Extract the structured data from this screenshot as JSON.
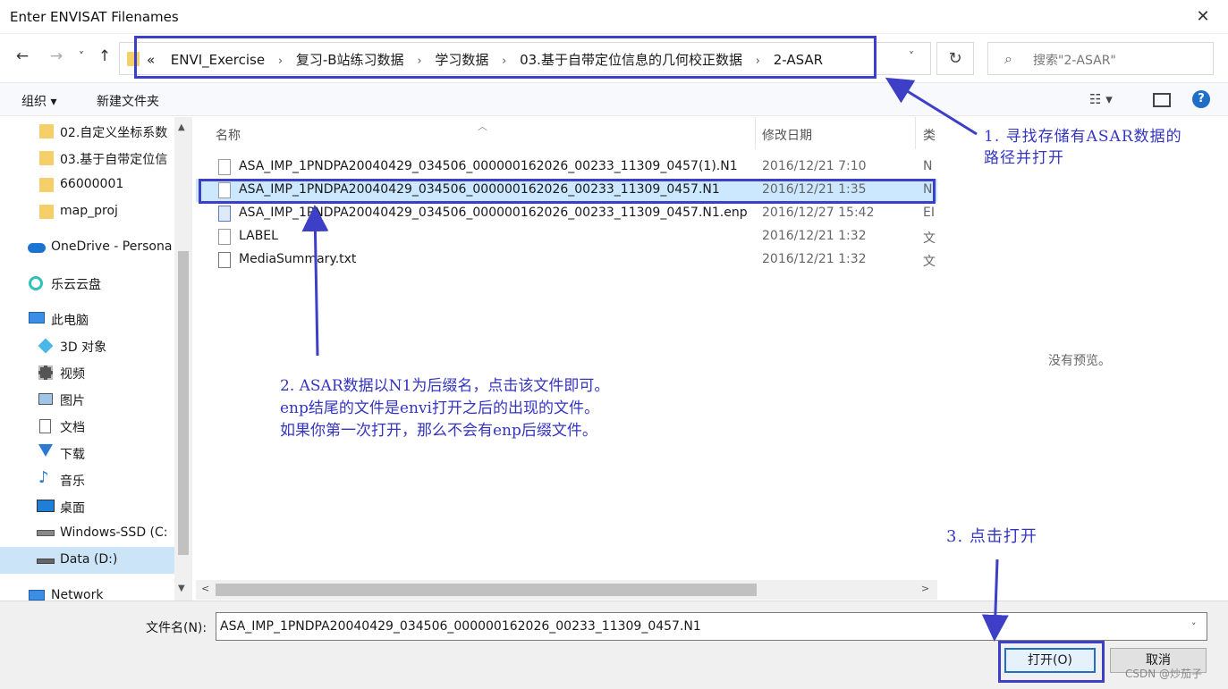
{
  "window": {
    "title": "Enter ENVISAT Filenames",
    "close_glyph": "✕"
  },
  "nav": {
    "back_icon": "←",
    "forward_icon": "→",
    "recent_icon": "˅",
    "up_icon": "↑",
    "crumb_prefix": "«",
    "crumbs": [
      "ENVI_Exercise",
      "复习-B站练习数据",
      "学习数据",
      "03.基于自带定位信息的几何校正数据",
      "2-ASAR"
    ],
    "crumb_sep": "›",
    "dropdown_icon": "˅",
    "refresh_icon": "↻",
    "search_icon": "⌕",
    "search_placeholder": "搜索\"2-ASAR\""
  },
  "toolbar": {
    "organize": "组织 ▾",
    "new_folder": "新建文件夹",
    "view_icon": "☷ ▾",
    "help_icon": "?"
  },
  "sidebar": {
    "items": [
      {
        "label": "02.自定义坐标系数",
        "icon": "folder-icon"
      },
      {
        "label": "03.基于自带定位信",
        "icon": "folder-icon"
      },
      {
        "label": "66000001",
        "icon": "folder-icon"
      },
      {
        "label": "map_proj",
        "icon": "folder-icon"
      },
      {
        "label": "OneDrive - Persona",
        "icon": "cloud-icon"
      },
      {
        "label": "乐云云盘",
        "icon": "cloud-drive-icon"
      },
      {
        "label": "此电脑",
        "icon": "computer-icon"
      },
      {
        "label": "3D 对象",
        "icon": "cube-icon"
      },
      {
        "label": "视频",
        "icon": "video-icon"
      },
      {
        "label": "图片",
        "icon": "picture-icon"
      },
      {
        "label": "文档",
        "icon": "document-icon"
      },
      {
        "label": "下载",
        "icon": "download-icon"
      },
      {
        "label": "音乐",
        "icon": "music-icon"
      },
      {
        "label": "桌面",
        "icon": "desktop-icon"
      },
      {
        "label": "Windows-SSD (C:",
        "icon": "drive-icon"
      },
      {
        "label": "Data (D:)",
        "icon": "drive-icon"
      },
      {
        "label": "Network",
        "icon": "network-icon"
      }
    ],
    "scroll_up": "▲",
    "scroll_down": "▼"
  },
  "filelist": {
    "columns": {
      "name": "名称",
      "date": "修改日期",
      "type": "类"
    },
    "sort_arrow": "︿",
    "files": [
      {
        "name": "ASA_IMP_1PNDPA20040429_034506_000000162026_00233_11309_0457(1).N1",
        "date": "2016/12/21 7:10",
        "type": "N"
      },
      {
        "name": "ASA_IMP_1PNDPA20040429_034506_000000162026_00233_11309_0457.N1",
        "date": "2016/12/21 1:35",
        "type": "N"
      },
      {
        "name": "ASA_IMP_1PNDPA20040429_034506_000000162026_00233_11309_0457.N1.enp",
        "date": "2016/12/27 15:42",
        "type": "EI"
      },
      {
        "name": "LABEL",
        "date": "2016/12/21 1:32",
        "type": "文"
      },
      {
        "name": "MediaSummary.txt",
        "date": "2016/12/21 1:32",
        "type": "文"
      }
    ],
    "hscroll_left": "<",
    "hscroll_right": ">"
  },
  "preview": {
    "message": "没有预览。"
  },
  "bottom": {
    "filename_label": "文件名(N):",
    "filename_value": "ASA_IMP_1PNDPA20040429_034506_000000162026_00233_11309_0457.N1",
    "dropdown_icon": "˅",
    "open_button": "打开(O)",
    "cancel_button": "取消"
  },
  "annotations": {
    "a1_line1": "1. 寻找存储有ASAR数据的",
    "a1_line2": "路径并打开",
    "a2_line1": "2. ASAR数据以N1为后缀名，点击该文件即可。",
    "a2_line2": "enp结尾的文件是envi打开之后的出现的文件。",
    "a2_line3": "如果你第一次打开，那么不会有enp后缀文件。",
    "a3": "3. 点击打开"
  },
  "watermark": "CSDN @炒茄子",
  "colors": {
    "annotation": "#3d3fc6",
    "selection": "#cce8ff",
    "folder": "#f5cf6a"
  }
}
